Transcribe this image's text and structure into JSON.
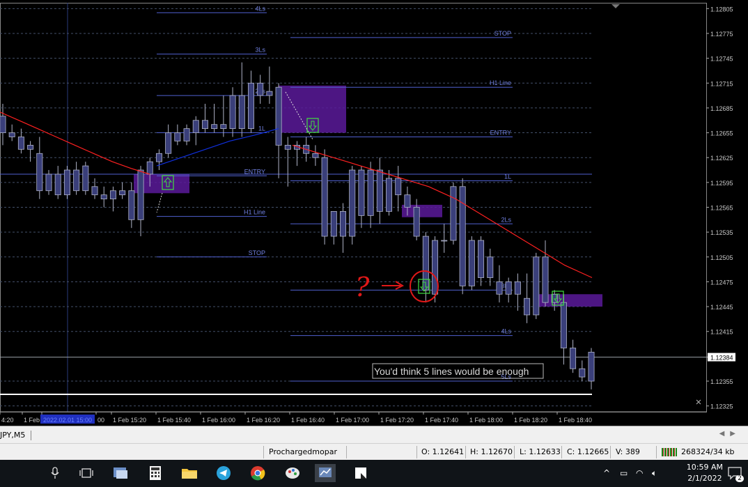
{
  "chart_data": {
    "type": "candlestick",
    "symbol_tab": "JPY,M5",
    "price_axis_ticks": [
      "1.12805",
      "1.12775",
      "1.12745",
      "1.12715",
      "1.12685",
      "1.12655",
      "1.12625",
      "1.12595",
      "1.12565",
      "1.12535",
      "1.12505",
      "1.12475",
      "1.12445",
      "1.12415",
      "1.12384",
      "1.12355",
      "1.12325"
    ],
    "current_price": "1.12384",
    "time_axis_ticks": [
      "4:20",
      "1 Feb",
      "2022.02.01 15:00",
      "00",
      "1 Feb 15:20",
      "1 Feb 15:40",
      "1 Feb 16:00",
      "1 Feb 16:20",
      "1 Feb 16:40",
      "1 Feb 17:00",
      "1 Feb 17:20",
      "1 Feb 17:40",
      "1 Feb 18:00",
      "1 Feb 18:20",
      "1 Feb 18:40"
    ],
    "candles": [
      {
        "o": 1.12675,
        "h": 1.1269,
        "l": 1.1264,
        "c": 1.12655
      },
      {
        "o": 1.12655,
        "h": 1.12665,
        "l": 1.12645,
        "c": 1.1265
      },
      {
        "o": 1.1265,
        "h": 1.1266,
        "l": 1.1263,
        "c": 1.12635
      },
      {
        "o": 1.12635,
        "h": 1.12645,
        "l": 1.1262,
        "c": 1.1264
      },
      {
        "o": 1.1263,
        "h": 1.1265,
        "l": 1.12575,
        "c": 1.12585
      },
      {
        "o": 1.12585,
        "h": 1.1261,
        "l": 1.1258,
        "c": 1.12605
      },
      {
        "o": 1.12605,
        "h": 1.12615,
        "l": 1.12575,
        "c": 1.1258
      },
      {
        "o": 1.1258,
        "h": 1.12615,
        "l": 1.12575,
        "c": 1.1261
      },
      {
        "o": 1.1261,
        "h": 1.1262,
        "l": 1.1258,
        "c": 1.12585
      },
      {
        "o": 1.12585,
        "h": 1.1262,
        "l": 1.1258,
        "c": 1.12615
      },
      {
        "o": 1.1259,
        "h": 1.126,
        "l": 1.12575,
        "c": 1.1258
      },
      {
        "o": 1.1258,
        "h": 1.1259,
        "l": 1.12565,
        "c": 1.12575
      },
      {
        "o": 1.12575,
        "h": 1.1259,
        "l": 1.1256,
        "c": 1.12585
      },
      {
        "o": 1.12585,
        "h": 1.12595,
        "l": 1.12575,
        "c": 1.1258
      },
      {
        "o": 1.12585,
        "h": 1.12595,
        "l": 1.1254,
        "c": 1.1255
      },
      {
        "o": 1.1255,
        "h": 1.12615,
        "l": 1.1253,
        "c": 1.1261
      },
      {
        "o": 1.12605,
        "h": 1.12625,
        "l": 1.1259,
        "c": 1.1262
      },
      {
        "o": 1.1262,
        "h": 1.12635,
        "l": 1.1261,
        "c": 1.1263
      },
      {
        "o": 1.1263,
        "h": 1.12665,
        "l": 1.12625,
        "c": 1.12655
      },
      {
        "o": 1.12655,
        "h": 1.12665,
        "l": 1.1264,
        "c": 1.12645
      },
      {
        "o": 1.12645,
        "h": 1.12665,
        "l": 1.1264,
        "c": 1.1266
      },
      {
        "o": 1.12655,
        "h": 1.12675,
        "l": 1.1264,
        "c": 1.1267
      },
      {
        "o": 1.1267,
        "h": 1.1269,
        "l": 1.12655,
        "c": 1.1266
      },
      {
        "o": 1.1266,
        "h": 1.1269,
        "l": 1.12655,
        "c": 1.12665
      },
      {
        "o": 1.12665,
        "h": 1.127,
        "l": 1.1265,
        "c": 1.1266
      },
      {
        "o": 1.1266,
        "h": 1.1271,
        "l": 1.1265,
        "c": 1.127
      },
      {
        "o": 1.127,
        "h": 1.1274,
        "l": 1.1265,
        "c": 1.1266
      },
      {
        "o": 1.1266,
        "h": 1.1273,
        "l": 1.12655,
        "c": 1.12715
      },
      {
        "o": 1.12715,
        "h": 1.12725,
        "l": 1.1269,
        "c": 1.127
      },
      {
        "o": 1.12705,
        "h": 1.12735,
        "l": 1.1269,
        "c": 1.127
      },
      {
        "o": 1.1271,
        "h": 1.12715,
        "l": 1.126,
        "c": 1.1264
      },
      {
        "o": 1.1264,
        "h": 1.1265,
        "l": 1.1259,
        "c": 1.12635
      },
      {
        "o": 1.12635,
        "h": 1.12645,
        "l": 1.12615,
        "c": 1.1264
      },
      {
        "o": 1.1264,
        "h": 1.1265,
        "l": 1.1262,
        "c": 1.1263
      },
      {
        "o": 1.1263,
        "h": 1.1264,
        "l": 1.12615,
        "c": 1.12625
      },
      {
        "o": 1.12625,
        "h": 1.12635,
        "l": 1.1252,
        "c": 1.1253
      },
      {
        "o": 1.1253,
        "h": 1.1256,
        "l": 1.1252,
        "c": 1.1256
      },
      {
        "o": 1.1256,
        "h": 1.1257,
        "l": 1.1251,
        "c": 1.1253
      },
      {
        "o": 1.1253,
        "h": 1.12615,
        "l": 1.1252,
        "c": 1.1261
      },
      {
        "o": 1.1261,
        "h": 1.12615,
        "l": 1.1254,
        "c": 1.12555
      },
      {
        "o": 1.12555,
        "h": 1.1262,
        "l": 1.1254,
        "c": 1.1261
      },
      {
        "o": 1.1261,
        "h": 1.12625,
        "l": 1.12545,
        "c": 1.1256
      },
      {
        "o": 1.1256,
        "h": 1.1261,
        "l": 1.12555,
        "c": 1.126
      },
      {
        "o": 1.126,
        "h": 1.12615,
        "l": 1.1256,
        "c": 1.1258
      },
      {
        "o": 1.1258,
        "h": 1.1259,
        "l": 1.12555,
        "c": 1.12565
      },
      {
        "o": 1.12565,
        "h": 1.12575,
        "l": 1.12525,
        "c": 1.1253
      },
      {
        "o": 1.1253,
        "h": 1.12535,
        "l": 1.1245,
        "c": 1.12465
      },
      {
        "o": 1.1246,
        "h": 1.1253,
        "l": 1.1245,
        "c": 1.12525
      },
      {
        "o": 1.12525,
        "h": 1.12545,
        "l": 1.1251,
        "c": 1.12525
      },
      {
        "o": 1.12525,
        "h": 1.12595,
        "l": 1.1252,
        "c": 1.1259
      },
      {
        "o": 1.1259,
        "h": 1.126,
        "l": 1.1246,
        "c": 1.1247
      },
      {
        "o": 1.1247,
        "h": 1.1253,
        "l": 1.12465,
        "c": 1.12525
      },
      {
        "o": 1.12525,
        "h": 1.1253,
        "l": 1.1247,
        "c": 1.1248
      },
      {
        "o": 1.1248,
        "h": 1.12515,
        "l": 1.1247,
        "c": 1.12505
      },
      {
        "o": 1.12475,
        "h": 1.12495,
        "l": 1.1245,
        "c": 1.1246
      },
      {
        "o": 1.1246,
        "h": 1.1248,
        "l": 1.1245,
        "c": 1.12475
      },
      {
        "o": 1.12475,
        "h": 1.12485,
        "l": 1.1244,
        "c": 1.1246
      },
      {
        "o": 1.12455,
        "h": 1.12485,
        "l": 1.12425,
        "c": 1.12435
      },
      {
        "o": 1.12435,
        "h": 1.1251,
        "l": 1.1243,
        "c": 1.12505
      },
      {
        "o": 1.12505,
        "h": 1.12525,
        "l": 1.12445,
        "c": 1.1245
      },
      {
        "o": 1.1245,
        "h": 1.12465,
        "l": 1.1244,
        "c": 1.1246
      },
      {
        "o": 1.1245,
        "h": 1.1246,
        "l": 1.12375,
        "c": 1.12395
      },
      {
        "o": 1.12395,
        "h": 1.12405,
        "l": 1.12365,
        "c": 1.1237
      },
      {
        "o": 1.1237,
        "h": 1.1238,
        "l": 1.12355,
        "c": 1.1236
      },
      {
        "o": 1.12355,
        "h": 1.12395,
        "l": 1.12345,
        "c": 1.1239
      }
    ],
    "ma_red": [
      1.1268,
      1.1267,
      1.1266,
      1.1265,
      1.1264,
      1.1263,
      1.1262,
      1.12612,
      1.12605,
      1.1264,
      1.1263,
      1.1262,
      1.1261,
      1.126,
      1.1259,
      1.12575,
      1.12555,
      1.12535,
      1.12515,
      1.12495,
      1.1248
    ],
    "ma_blue": [
      1.12615,
      1.12625,
      1.12635,
      1.12645,
      1.12652,
      1.1266
    ],
    "levels_left": [
      {
        "label": "4Ls",
        "price": 1.128
      },
      {
        "label": "3Ls",
        "price": 1.1275
      },
      {
        "label": "2Ls",
        "price": 1.127
      },
      {
        "label": "1L",
        "price": 1.12655
      },
      {
        "label": "ENTRY",
        "price": 1.12603
      },
      {
        "label": "H1 Line",
        "price": 1.12554
      },
      {
        "label": "STOP",
        "price": 1.12505
      }
    ],
    "levels_right": [
      {
        "label": "STOP",
        "price": 1.1277
      },
      {
        "label": "H1 Line",
        "price": 1.1271
      },
      {
        "label": "ENTRY",
        "price": 1.1265
      },
      {
        "label": "1L",
        "price": 1.12597
      },
      {
        "label": "2Ls",
        "price": 1.12545
      },
      {
        "label": "3Ls",
        "price": 1.12465
      },
      {
        "label": "4Ls",
        "price": 1.1241
      },
      {
        "label": "5Ls",
        "price": 1.12355
      }
    ],
    "annotation": "You'd think 5 lines would be enough",
    "scribble": "?",
    "colors": {
      "candle": "#3a3f7a",
      "level": "#5060d0",
      "box": "#5b1a9a",
      "ma_red": "#ff2020",
      "ma_blue": "#1030e0",
      "scribble": "#e01818"
    }
  },
  "tabbar": {
    "symbol": "JPY,M5"
  },
  "statusbar": {
    "profile": "Prochargedmopar",
    "open": "O: 1.12641",
    "high": "H: 1.12670",
    "low": "L: 1.12633",
    "close": "C: 1.12665",
    "volume": "V: 389",
    "traffic": "268324/34 kb"
  },
  "taskbar": {
    "time": "10:59 AM",
    "date": "2/1/2022",
    "notifications": "2",
    "icons": [
      "microphone-icon",
      "task-view-icon",
      "app-icon",
      "calculator-icon",
      "file-explorer-icon",
      "telegram-icon",
      "chrome-icon",
      "paint-icon",
      "metatrader-icon",
      "notes-icon"
    ]
  }
}
